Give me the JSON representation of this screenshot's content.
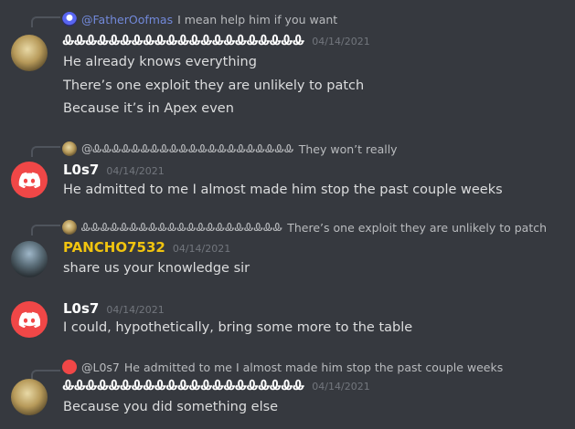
{
  "colors": {
    "background": "#36393f",
    "mention": "#7289da",
    "discord_red": "#f04747",
    "pancho_gold": "#f1c40f"
  },
  "messages": [
    {
      "reply": {
        "name": "@FatherOofmas",
        "text": "I mean help him if you want",
        "icon": "blue-avatar-icon"
      },
      "author": "ᎲᎲᎲᎲᎲᎲᎲᎲᎲᎲᎲᎲᎲᎲᎲᎲᎲᎲᎲᎲᎲ",
      "timestamp": "04/14/2021",
      "lines": [
        "He already knows everything",
        "There’s one exploit they are unlikely to patch",
        "Because it’s in Apex even"
      ]
    },
    {
      "reply": {
        "name": "@ᎲᎲᎲᎲᎲᎲᎲᎲᎲᎲᎲᎲᎲᎲᎲᎲᎲᎲᎲᎲᎲ",
        "text": "They won’t really",
        "icon": "statue-avatar-icon"
      },
      "author": "L0s7",
      "timestamp": "04/14/2021",
      "lines": [
        "He admitted to me I almost made him stop the past couple weeks"
      ]
    },
    {
      "reply": {
        "name": "ᎲᎲᎲᎲᎲᎲᎲᎲᎲᎲᎲᎲᎲᎲᎲᎲᎲᎲᎲᎲᎲ",
        "text": "There’s one exploit they are unlikely to patch",
        "icon": "statue-avatar-icon"
      },
      "author": "PANCHO7532",
      "timestamp": "04/14/2021",
      "lines": [
        "share us your knowledge sir"
      ]
    },
    {
      "author": "L0s7",
      "timestamp": "04/14/2021",
      "lines": [
        "I could, hypothetically, bring some more to the table"
      ]
    },
    {
      "reply": {
        "name": "@L0s7",
        "text": "He admitted to me I almost made him stop the past couple weeks",
        "icon": "discord-avatar-icon"
      },
      "author": "ᎲᎲᎲᎲᎲᎲᎲᎲᎲᎲᎲᎲᎲᎲᎲᎲᎲᎲᎲᎲᎲ",
      "timestamp": "04/14/2021",
      "lines": [
        "Because you did something else"
      ]
    }
  ]
}
